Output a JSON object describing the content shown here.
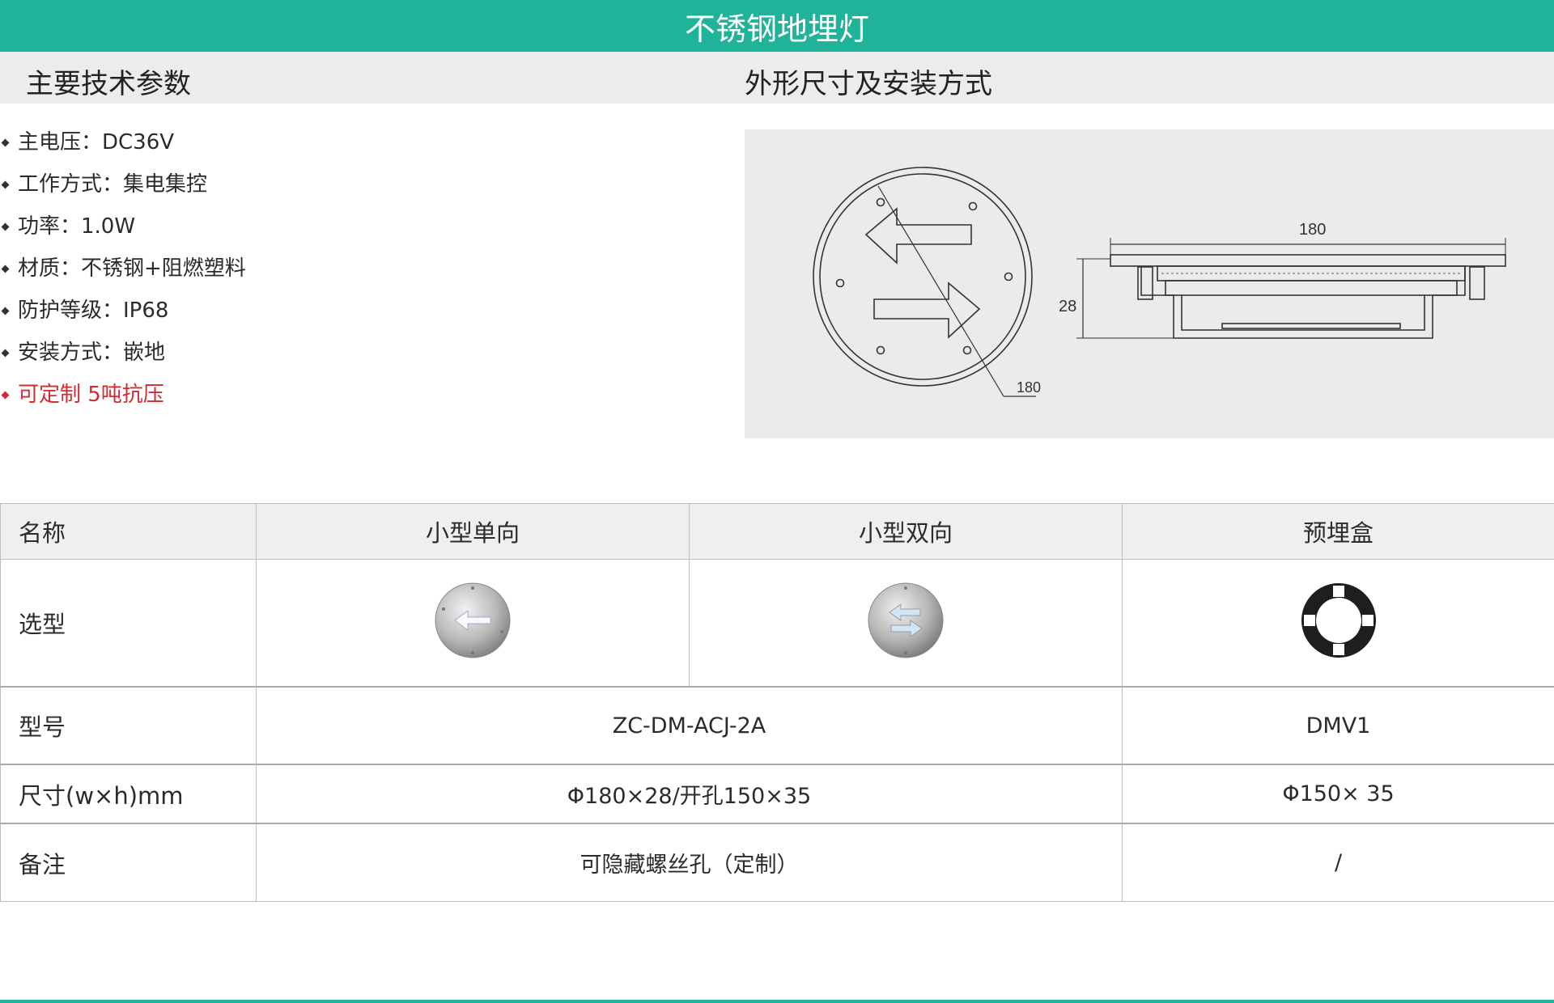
{
  "page": {
    "title": "不锈钢地埋灯"
  },
  "sections": {
    "params_title": "主要技术参数",
    "dims_title": "外形尺寸及安装方式"
  },
  "specs": [
    {
      "text": "主电压：DC36V"
    },
    {
      "text": "工作方式：集电集控"
    },
    {
      "text": "功率：1.0W"
    },
    {
      "text": "材质：不锈钢+阻燃塑料"
    },
    {
      "text": "防护等级：IP68"
    },
    {
      "text": "安装方式：嵌地"
    },
    {
      "text": "可定制 5吨抗压"
    }
  ],
  "drawing": {
    "dim_diameter": "180",
    "dim_width": "180",
    "dim_height": "28"
  },
  "table": {
    "header": {
      "label": "名称",
      "col1": "小型单向",
      "col2": "小型双向",
      "col3": "预埋盒"
    },
    "select_label": "选型",
    "model": {
      "label": "型号",
      "lamp": "ZC-DM-ACJ-2A",
      "box": "DMV1"
    },
    "size": {
      "label": "尺寸(w×h)mm",
      "lamp": "Φ180×28/开孔150×35",
      "box": "Φ150× 35"
    },
    "note": {
      "label": "备注",
      "lamp": "可隐藏螺丝孔（定制）",
      "box": "/"
    }
  },
  "colors": {
    "accent": "#1fb39a",
    "highlight": "#d22b32",
    "header_bg": "#efefef",
    "drawing_bg": "#ebebeb"
  },
  "icons": [
    "single-direction-lamp-icon",
    "double-direction-lamp-icon",
    "embedded-box-icon"
  ]
}
